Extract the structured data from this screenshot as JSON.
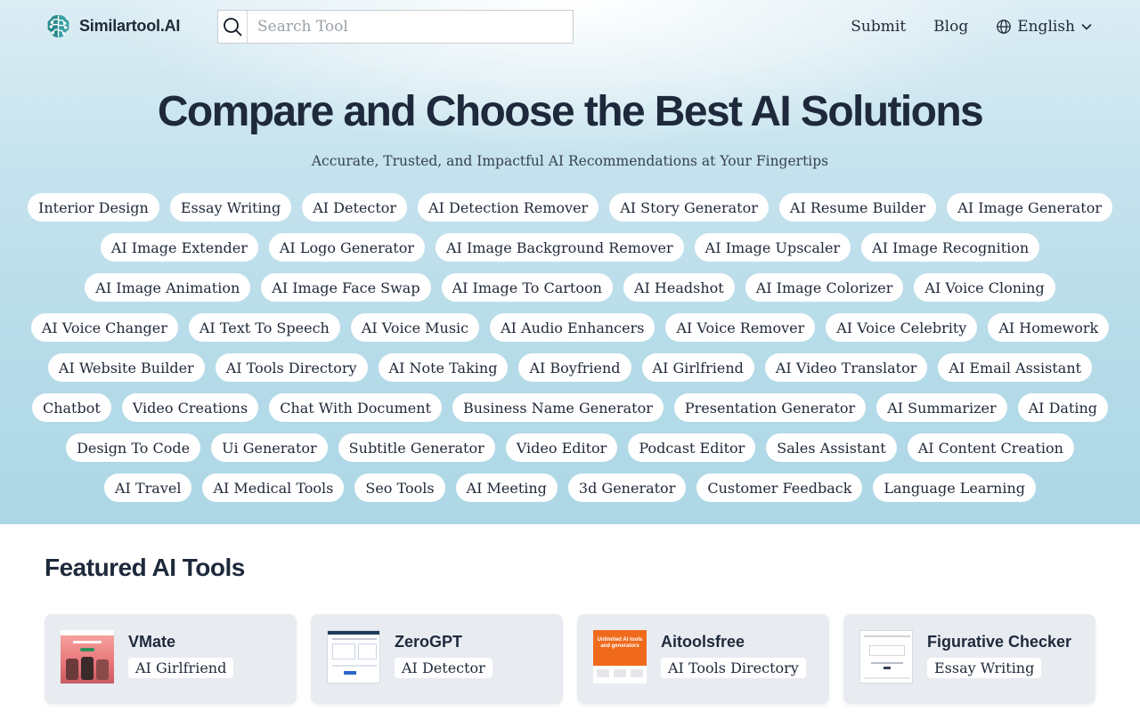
{
  "header": {
    "logo_text": "Similartool.AI",
    "search_placeholder": "Search Tool",
    "nav": {
      "submit": "Submit",
      "blog": "Blog",
      "language": "English"
    }
  },
  "hero": {
    "title": "Compare and Choose the Best AI Solutions",
    "subtitle": "Accurate, Trusted, and Impactful AI Recommendations at Your Fingertips"
  },
  "tag_rows": [
    [
      "Interior Design",
      "Essay Writing",
      "AI Detector",
      "AI Detection Remover",
      "AI Story Generator",
      "AI Resume Builder",
      "AI Image Generator"
    ],
    [
      "AI Image Extender",
      "AI Logo Generator",
      "AI Image Background Remover",
      "AI Image Upscaler",
      "AI Image Recognition"
    ],
    [
      "AI Image Animation",
      "AI Image Face Swap",
      "AI Image To Cartoon",
      "AI Headshot",
      "AI Image Colorizer",
      "AI Voice Cloning"
    ],
    [
      "AI Voice Changer",
      "AI Text To Speech",
      "AI Voice Music",
      "AI Audio Enhancers",
      "AI Voice Remover",
      "AI Voice Celebrity",
      "AI Homework"
    ],
    [
      "AI Website Builder",
      "AI Tools Directory",
      "AI Note Taking",
      "AI Boyfriend",
      "AI Girlfriend",
      "AI Video Translator",
      "AI Email Assistant"
    ],
    [
      "Chatbot",
      "Video Creations",
      "Chat With Document",
      "Business Name Generator",
      "Presentation Generator",
      "AI Summarizer",
      "AI Dating"
    ],
    [
      "Design To Code",
      "Ui Generator",
      "Subtitle Generator",
      "Video Editor",
      "Podcast Editor",
      "Sales Assistant",
      "AI Content Creation"
    ],
    [
      "AI Travel",
      "AI Medical Tools",
      "Seo Tools",
      "AI Meeting",
      "3d Generator",
      "Customer Feedback",
      "Language Learning"
    ]
  ],
  "featured": {
    "title": "Featured AI Tools",
    "cards": [
      {
        "name": "VMate",
        "category": "AI Girlfriend"
      },
      {
        "name": "ZeroGPT",
        "category": "AI Detector"
      },
      {
        "name": "Aitoolsfree",
        "category": "AI Tools Directory",
        "thumb_text": "Unlimited AI tools and generators"
      },
      {
        "name": "Figurative Checker",
        "category": "Essay Writing"
      }
    ]
  },
  "colors": {
    "hero_bg": "#b5dbe8",
    "title": "#1e293b",
    "logo_teal": "#2b8a8e",
    "card_bg": "#e8ecf1",
    "tag_bg": "#ffffff"
  },
  "icons": [
    "brain-circuit-logo-icon",
    "search-icon",
    "globe-icon",
    "chevron-down-icon"
  ]
}
